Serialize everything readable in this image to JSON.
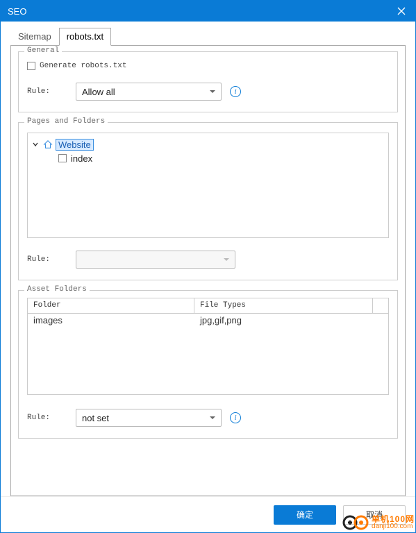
{
  "window": {
    "title": "SEO"
  },
  "tabs": {
    "sitemap": "Sitemap",
    "robots": "robots.txt",
    "active": "robots"
  },
  "general": {
    "legend": "General",
    "generate_label": "Generate robots.txt",
    "generate_checked": false,
    "rule_label": "Rule:",
    "rule_value": "Allow all"
  },
  "pages": {
    "legend": "Pages and Folders",
    "tree": {
      "root": {
        "label": "Website",
        "expanded": true,
        "selected": true
      },
      "child": {
        "label": "index",
        "checked": false
      }
    },
    "rule_label": "Rule:",
    "rule_value": ""
  },
  "assets": {
    "legend": "Asset Folders",
    "col_folder": "Folder",
    "col_types": "File Types",
    "rows": [
      {
        "folder": "images",
        "types": "jpg,gif,png"
      }
    ],
    "rule_label": "Rule:",
    "rule_value": "not set"
  },
  "footer": {
    "ok": "确定",
    "cancel": "取消"
  },
  "watermark": {
    "line1": "单机100网",
    "line2": "danji100.com"
  }
}
